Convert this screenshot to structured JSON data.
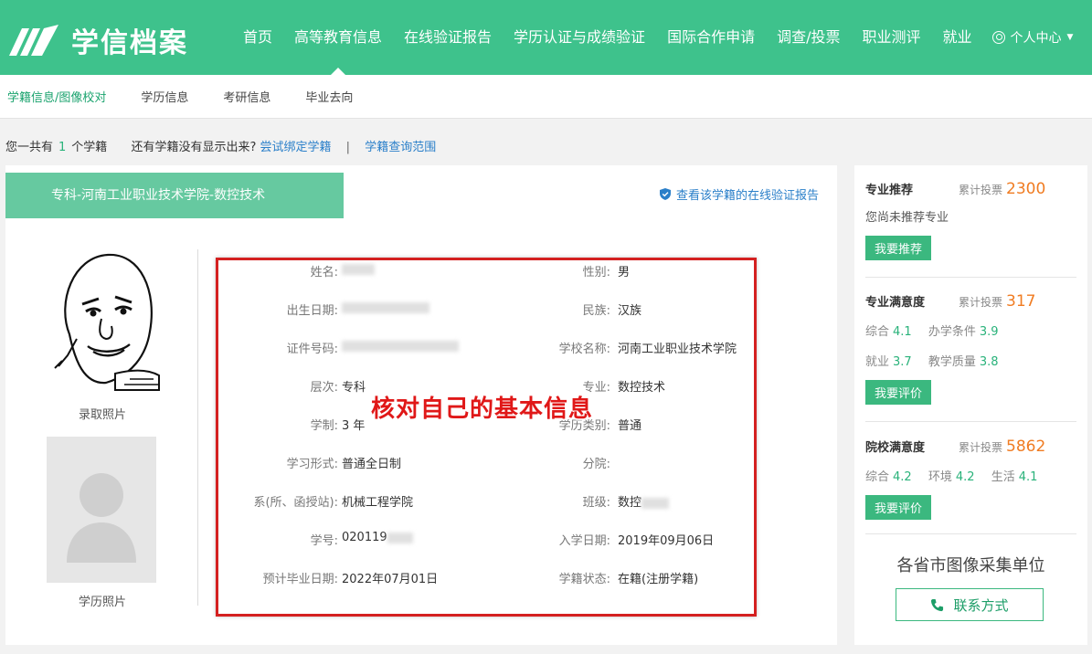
{
  "header": {
    "logo_text": "学信档案",
    "nav": [
      "首页",
      "高等教育信息",
      "在线验证报告",
      "学历认证与成绩验证",
      "国际合作申请",
      "调查/投票",
      "职业测评",
      "就业"
    ],
    "active_nav_index": 1,
    "user_center": "个人中心",
    "brand_color": "#3ec28c"
  },
  "subnav": {
    "items": [
      "学籍信息/图像校对",
      "学历信息",
      "考研信息",
      "毕业去向"
    ],
    "active_index": 0
  },
  "infoline": {
    "prefix": "您一共有",
    "count": "1",
    "suffix": "个学籍",
    "question": "还有学籍没有显示出来?",
    "link1": "尝试绑定学籍",
    "separator": "|",
    "link2": "学籍查询范围"
  },
  "record": {
    "school_tab": "专科-河南工业职业技术学院-数控技术",
    "verify_link": "查看该学籍的在线验证报告",
    "photo1_label": "录取照片",
    "photo2_label": "学历照片",
    "fields_left": [
      {
        "label": "姓名:",
        "value": ""
      },
      {
        "label": "出生日期:",
        "value": ""
      },
      {
        "label": "证件号码:",
        "value": ""
      },
      {
        "label": "层次:",
        "value": "专科"
      },
      {
        "label": "学制:",
        "value": "3 年"
      },
      {
        "label": "学习形式:",
        "value": "普通全日制"
      },
      {
        "label": "系(所、函授站):",
        "value": "机械工程学院"
      },
      {
        "label": "学号:",
        "value": "020119"
      },
      {
        "label": "预计毕业日期:",
        "value": "2022年07月01日"
      }
    ],
    "fields_right": [
      {
        "label": "性别:",
        "value": "男"
      },
      {
        "label": "民族:",
        "value": "汉族"
      },
      {
        "label": "学校名称:",
        "value": "河南工业职业技术学院"
      },
      {
        "label": "专业:",
        "value": "数控技术"
      },
      {
        "label": "学历类别:",
        "value": "普通"
      },
      {
        "label": "分院:",
        "value": ""
      },
      {
        "label": "班级:",
        "value": "数控"
      },
      {
        "label": "入学日期:",
        "value": "2019年09月06日"
      },
      {
        "label": "学籍状态:",
        "value": "在籍(注册学籍)"
      }
    ],
    "annotation": "核对自己的基本信息"
  },
  "side": {
    "major_recommend": {
      "title": "专业推荐",
      "votes_label": "累计投票",
      "votes": "2300",
      "empty_text": "您尚未推荐专业",
      "button": "我要推荐"
    },
    "major_satisfaction": {
      "title": "专业满意度",
      "votes_label": "累计投票",
      "votes": "317",
      "row1": [
        {
          "label": "综合",
          "value": "4.1"
        },
        {
          "label": "办学条件",
          "value": "3.9"
        }
      ],
      "row2": [
        {
          "label": "就业",
          "value": "3.7"
        },
        {
          "label": "教学质量",
          "value": "3.8"
        }
      ],
      "button": "我要评价"
    },
    "school_satisfaction": {
      "title": "院校满意度",
      "votes_label": "累计投票",
      "votes": "5862",
      "row1": [
        {
          "label": "综合",
          "value": "4.2"
        },
        {
          "label": "环境",
          "value": "4.2"
        },
        {
          "label": "生活",
          "value": "4.1"
        }
      ],
      "button": "我要评价"
    },
    "collect_title": "各省市图像采集单位",
    "contact_button": "联系方式"
  }
}
